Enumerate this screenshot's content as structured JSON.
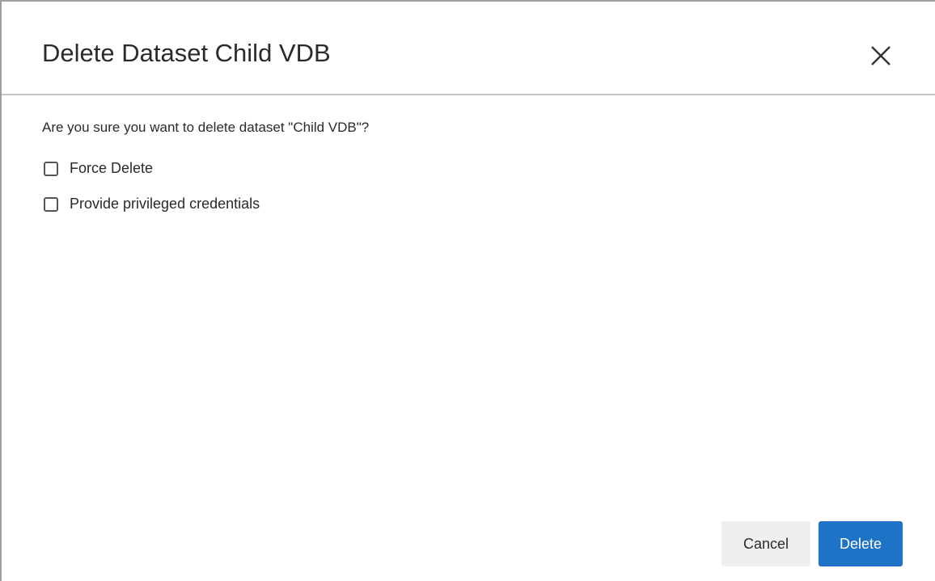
{
  "dialog": {
    "title": "Delete Dataset Child VDB",
    "close_icon": "close-icon",
    "question": "Are you sure you want to delete dataset \"Child VDB\"?",
    "options": [
      {
        "label": "Force Delete",
        "checked": false
      },
      {
        "label": "Provide privileged credentials",
        "checked": false
      }
    ],
    "buttons": {
      "cancel_label": "Cancel",
      "delete_label": "Delete"
    },
    "colors": {
      "primary": "#1f73c6",
      "secondary_bg": "#efefef"
    }
  }
}
